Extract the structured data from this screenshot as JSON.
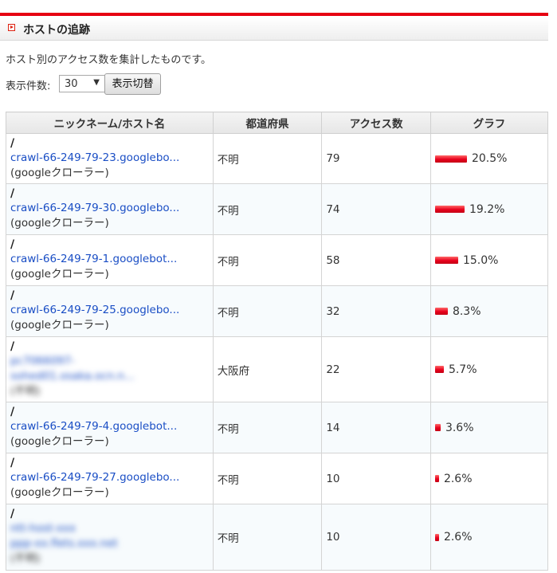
{
  "header": {
    "title": "ホストの追跡"
  },
  "description": "ホスト別のアクセス数を集計したものです。",
  "controls": {
    "display_count_label": "表示件数:",
    "display_count_value": "30",
    "switch_button": "表示切替"
  },
  "table": {
    "columns": [
      "ニックネーム/ホスト名",
      "都道府県",
      "アクセス数",
      "グラフ"
    ],
    "rows": [
      {
        "path": "/",
        "host": "crawl-66-249-79-23.googlebo...",
        "nickname": "(googleクローラー)",
        "prefecture": "不明",
        "count": "79",
        "percent": "20.5%",
        "ratio": 0.205,
        "blurred": false
      },
      {
        "path": "/",
        "host": "crawl-66-249-79-30.googlebo...",
        "nickname": "(googleクローラー)",
        "prefecture": "不明",
        "count": "74",
        "percent": "19.2%",
        "ratio": 0.192,
        "blurred": false
      },
      {
        "path": "/",
        "host": "crawl-66-249-79-1.googlebot...",
        "nickname": "(googleクローラー)",
        "prefecture": "不明",
        "count": "58",
        "percent": "15.0%",
        "ratio": 0.15,
        "blurred": false
      },
      {
        "path": "/",
        "host": "crawl-66-249-79-25.googlebo...",
        "nickname": "(googleクローラー)",
        "prefecture": "不明",
        "count": "32",
        "percent": "8.3%",
        "ratio": 0.083,
        "blurred": false
      },
      {
        "path": "/",
        "host": "pc7066097-",
        "host2": "sohed01.osaka.ocn.n...",
        "nickname": "(不明)",
        "prefecture": "大阪府",
        "count": "22",
        "percent": "5.7%",
        "ratio": 0.057,
        "blurred": true
      },
      {
        "path": "/",
        "host": "crawl-66-249-79-4.googlebot...",
        "nickname": "(googleクローラー)",
        "prefecture": "不明",
        "count": "14",
        "percent": "3.6%",
        "ratio": 0.036,
        "blurred": false
      },
      {
        "path": "/",
        "host": "crawl-66-249-79-27.googlebo...",
        "nickname": "(googleクローラー)",
        "prefecture": "不明",
        "count": "10",
        "percent": "2.6%",
        "ratio": 0.026,
        "blurred": false
      },
      {
        "path": "/",
        "host": "ntt-host-xxx",
        "host2": "ppp-xx.flets.xxx.net",
        "nickname": "(不明)",
        "prefecture": "不明",
        "count": "10",
        "percent": "2.6%",
        "ratio": 0.026,
        "blurred": true
      }
    ]
  },
  "colors": {
    "accent": "#e60012",
    "link": "#1a4ec5",
    "bar": "#e8001c"
  }
}
